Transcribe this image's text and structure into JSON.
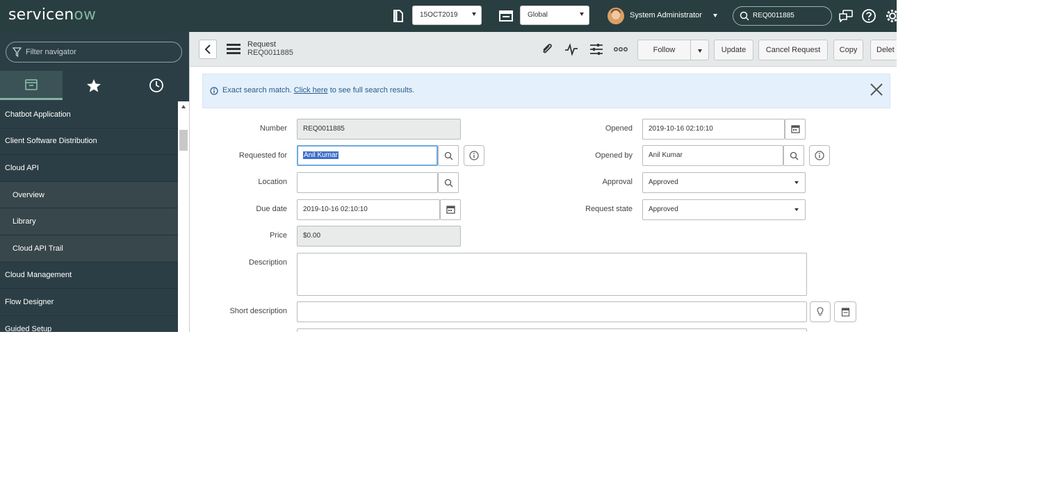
{
  "topbar": {
    "logo_left": "servicen",
    "logo_ow": "ow",
    "update_set": "15OCT2019",
    "application_scope": "Global",
    "user_name": "System Administrator",
    "search_value": "REQ0011885"
  },
  "navigator": {
    "filter_placeholder": "Filter navigator",
    "tabs": [
      "all-applications",
      "favorites",
      "history"
    ],
    "items": [
      {
        "label": "Chatbot Application",
        "sub": false
      },
      {
        "label": "Client Software Distribution",
        "sub": false
      },
      {
        "label": "Cloud API",
        "sub": false
      },
      {
        "label": "Overview",
        "sub": true
      },
      {
        "label": "Library",
        "sub": true
      },
      {
        "label": "Cloud API Trail",
        "sub": true
      },
      {
        "label": "Cloud Management",
        "sub": false
      },
      {
        "label": "Flow Designer",
        "sub": false
      },
      {
        "label": "Guided Setup",
        "sub": false
      }
    ]
  },
  "form": {
    "table_name": "Request",
    "record_number": "REQ0011885",
    "buttons": {
      "follow": "Follow",
      "update": "Update",
      "cancel_request": "Cancel Request",
      "copy": "Copy",
      "delete": "Delet"
    },
    "banner": {
      "prefix": "Exact search match.",
      "link": "Click here",
      "suffix": "to see full search results."
    },
    "fields": {
      "number": {
        "label": "Number",
        "value": "REQ0011885"
      },
      "requested_for": {
        "label": "Requested for",
        "value": "Anil Kumar"
      },
      "location": {
        "label": "Location",
        "value": ""
      },
      "due_date": {
        "label": "Due date",
        "value": "2019-10-16 02:10:10"
      },
      "price": {
        "label": "Price",
        "value": "$0.00"
      },
      "description": {
        "label": "Description",
        "value": ""
      },
      "short_description": {
        "label": "Short description",
        "value": ""
      },
      "opened": {
        "label": "Opened",
        "value": "2019-10-16 02:10:10"
      },
      "opened_by": {
        "label": "Opened by",
        "value": "Anil Kumar"
      },
      "approval": {
        "label": "Approval",
        "value": "Approved"
      },
      "request_state": {
        "label": "Request state",
        "value": "Approved"
      }
    }
  },
  "colors": {
    "banner": "#293e40",
    "navigator": "#2c3e45",
    "accent": "#81b5a1",
    "selection": "#3d6ec9"
  }
}
